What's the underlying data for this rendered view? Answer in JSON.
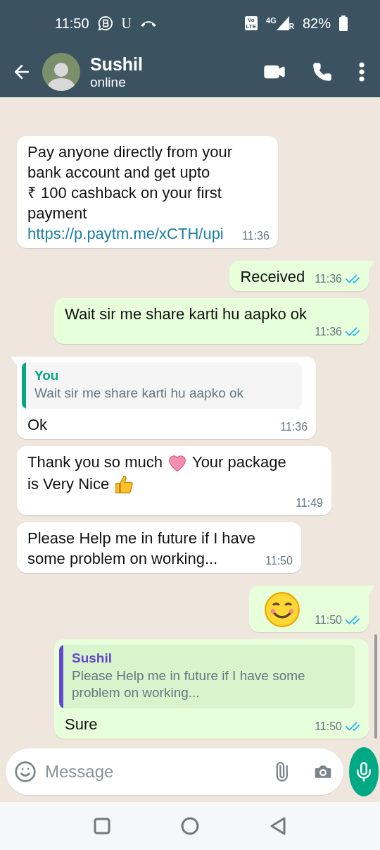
{
  "status_bar": {
    "time": "11:50",
    "letter": "U",
    "volte": [
      "Vo",
      "LTE"
    ],
    "network": "4G",
    "roaming": "R",
    "battery": "82%"
  },
  "header": {
    "name": "Sushil",
    "status": "online"
  },
  "messages": [
    {
      "kind": "received",
      "tail": false,
      "parts": [
        {
          "kind": "line",
          "text": "Pay anyone directly from your"
        },
        {
          "kind": "line",
          "text": "bank account and get upto"
        },
        {
          "kind": "line",
          "text": "₹ 100 cashback on your first"
        },
        {
          "kind": "line",
          "text": "payment"
        },
        {
          "kind": "link",
          "text": "https://p.paytm.me/xCTH/upi"
        }
      ],
      "time": "11:36"
    },
    {
      "kind": "sent",
      "tail": true,
      "parts": [
        {
          "kind": "text",
          "text": "Received"
        }
      ],
      "time": "11:36",
      "read": true
    },
    {
      "kind": "sent",
      "tail": false,
      "parts": [
        {
          "kind": "text",
          "text": "Wait sir me share karti hu aapko ok"
        }
      ],
      "time": "11:36",
      "read": true
    },
    {
      "kind": "received",
      "tail": true,
      "quote": {
        "author": "You",
        "text": "Wait sir me share karti hu aapko ok",
        "color": "#06a884"
      },
      "parts": [
        {
          "kind": "text",
          "text": "Ok"
        }
      ],
      "time": "11:36"
    },
    {
      "kind": "received",
      "tail": false,
      "parts": [
        {
          "kind": "text",
          "text": "Thank you so much"
        },
        {
          "kind": "heart"
        },
        {
          "kind": "text",
          "text": "Your package"
        },
        {
          "kind": "text",
          "text": "is Very Nice"
        },
        {
          "kind": "thumbs-up"
        }
      ],
      "time": "11:49"
    },
    {
      "kind": "received",
      "tail": false,
      "parts": [
        {
          "kind": "line",
          "text": "Please Help me in future if I have"
        },
        {
          "kind": "line",
          "text": "some problem on working..."
        }
      ],
      "time": "11:50"
    },
    {
      "kind": "sent",
      "tail": true,
      "parts": [
        {
          "kind": "smile"
        }
      ],
      "time": "11:50",
      "read": true
    },
    {
      "kind": "sent",
      "tail": false,
      "quote": {
        "author": "Sushil",
        "text": "Please Help me in future if I have some problem on working...",
        "color": "#5f4bcc"
      },
      "parts": [
        {
          "kind": "text",
          "text": "Sure"
        }
      ],
      "time": "11:50",
      "read": true
    }
  ],
  "composer": {
    "placeholder": "Message"
  }
}
